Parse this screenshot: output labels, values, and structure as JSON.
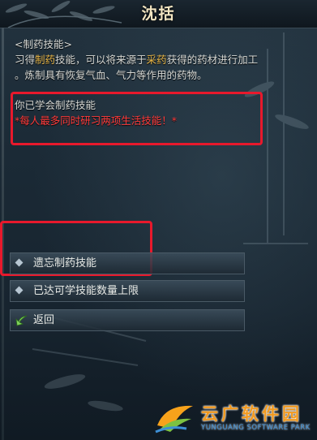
{
  "window": {
    "title": "沈括"
  },
  "description": {
    "heading": "<制药技能>",
    "line1_pre": "习得",
    "line1_hl1": "制药",
    "line1_mid": "技能，可以将来源于",
    "line1_hl2": "采药",
    "line1_post": "获得的药材进行加工",
    "line2": "。炼制具有恢复气血、气力等作用的药物。"
  },
  "status": {
    "learned": "你已学会制药技能",
    "warning": "*每人最多同时研习两项生活技能！*"
  },
  "options": [
    {
      "label": "遗忘制药技能"
    },
    {
      "label": "已达可学技能数量上限"
    },
    {
      "label": "返回"
    }
  ],
  "watermark": {
    "title": "云广软件园",
    "subtitle": "YUNGUANG SOFTWARE PARK"
  },
  "colors": {
    "highlight": "#e6b548",
    "warning": "#ff3b3b",
    "annotation_box": "#e8192c",
    "title": "#f3e6c2"
  }
}
